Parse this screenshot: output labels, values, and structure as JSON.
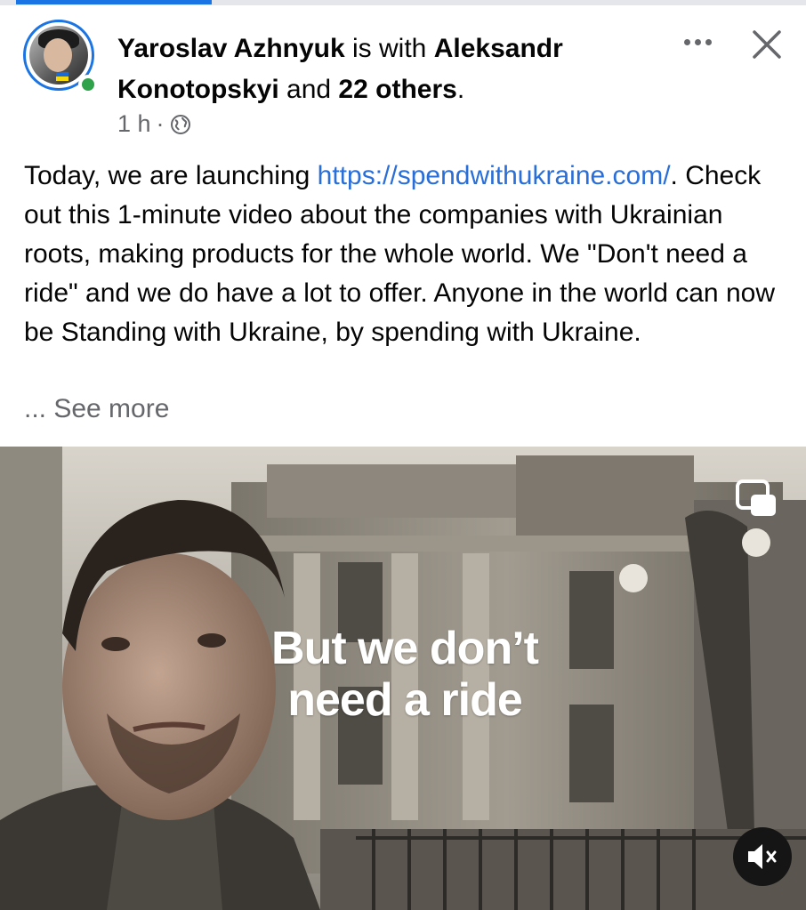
{
  "post": {
    "author": "Yaroslav Azhnyuk",
    "with_text": "is with",
    "tagged": "Aleksandr Konotopskyi",
    "and_text": "and",
    "others": "22 others",
    "period": ".",
    "time": "1 h",
    "separator": "·",
    "privacy_icon": "globe-icon",
    "body_before_link": "Today, we are launching ",
    "link": "https://spendwithukraine.com/",
    "body_after_link": ". Check out this 1-minute video about the companies with Ukrainian roots, making products for the whole world. We \"Don't need a ride\" and we do have a lot to offer. Anyone in the world can now be Standing with Ukraine, by spending with Ukraine.",
    "see_more": "... See more"
  },
  "video": {
    "caption_line1": "But we don’t",
    "caption_line2": "need a ride",
    "pip_icon": "picture-in-picture-icon",
    "mute_icon": "speaker-muted-icon"
  },
  "icons": {
    "more": "more-dots-icon",
    "close": "close-icon"
  },
  "colors": {
    "link": "#2a6ed8",
    "accent": "#1b74e4",
    "online": "#31a24c",
    "secondary_text": "#65676b"
  }
}
